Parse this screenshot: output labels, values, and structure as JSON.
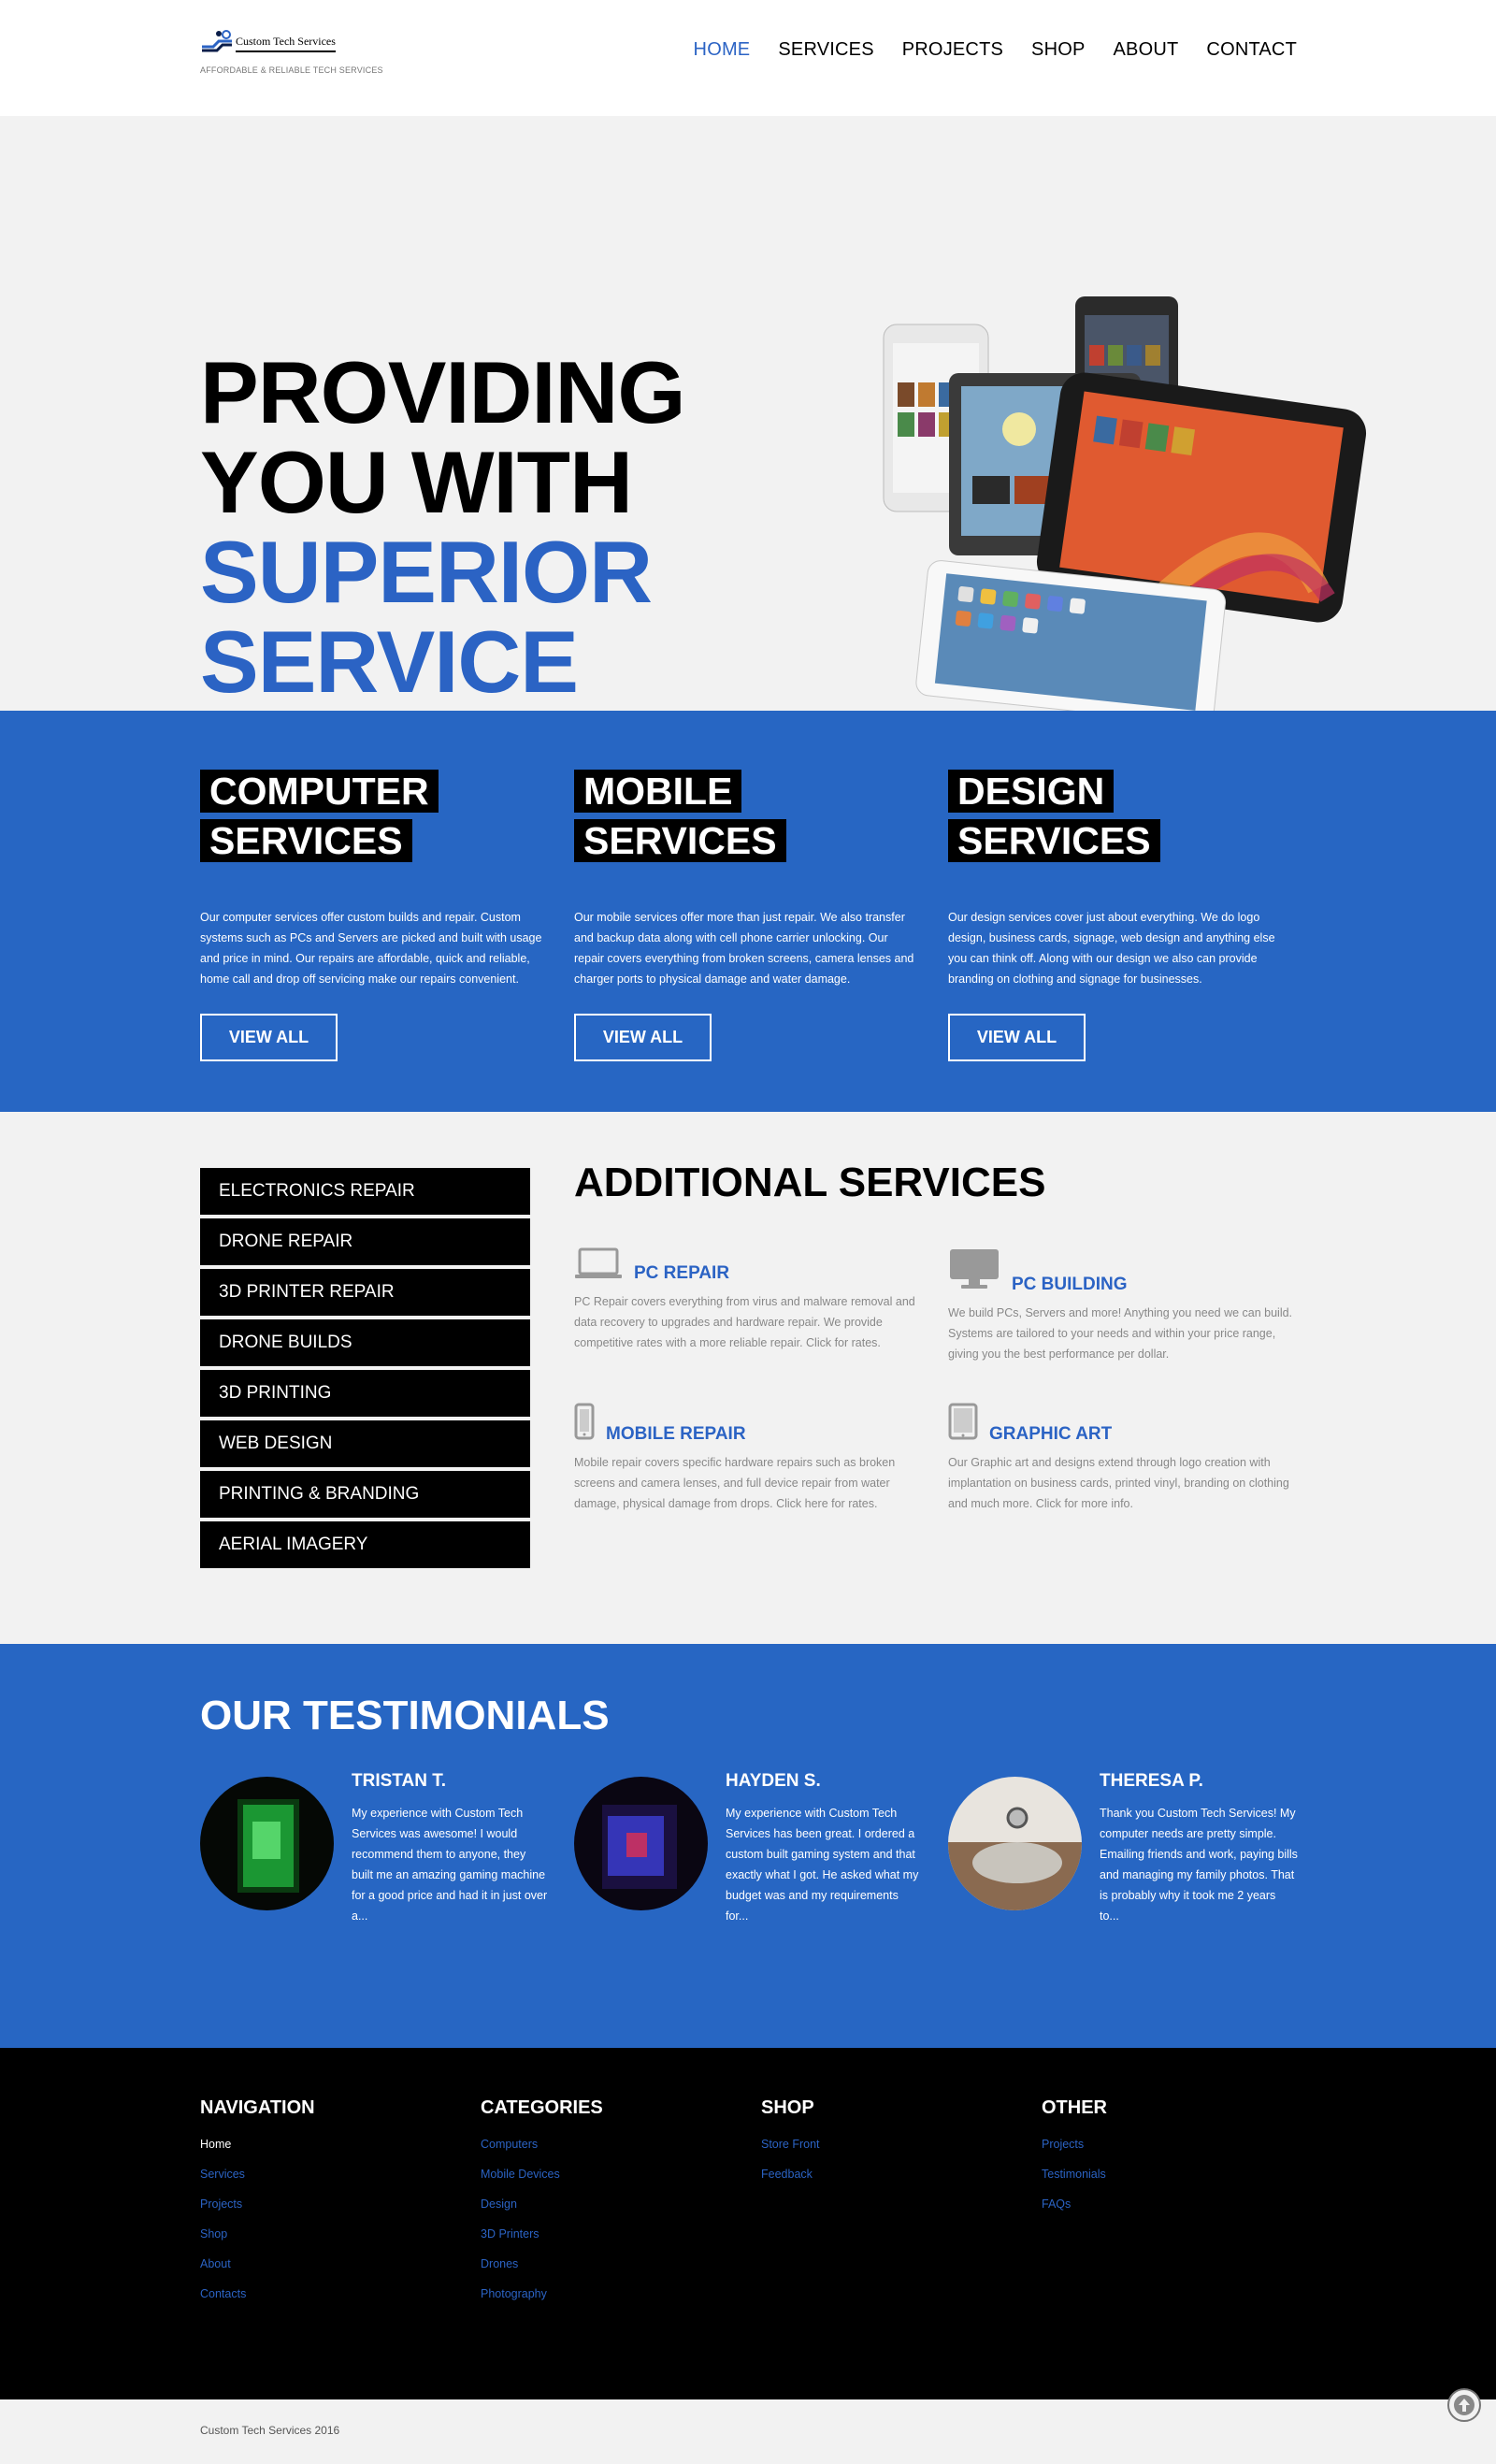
{
  "brand": {
    "name": "Custom Tech Services",
    "tagline": "AFFORDABLE & RELIABLE TECH SERVICES"
  },
  "nav": {
    "items": [
      "HOME",
      "SERVICES",
      "PROJECTS",
      "SHOP",
      "ABOUT",
      "CONTACT"
    ],
    "active": "HOME"
  },
  "hero": {
    "line1": "PROVIDING",
    "line2": "YOU WITH",
    "line3": "SUPERIOR",
    "line4": "SERVICE",
    "slide_count": 3,
    "active_slide": 1
  },
  "services": [
    {
      "title_line1": "COMPUTER",
      "title_line2": "SERVICES",
      "text": "Our computer services offer custom builds and repair. Custom systems such as PCs and Servers are picked and built with usage and price in mind. Our repairs are affordable, quick and reliable, home call and drop off servicing make our repairs convenient.",
      "button": "VIEW ALL"
    },
    {
      "title_line1": "MOBILE",
      "title_line2": "SERVICES",
      "text": "Our mobile services offer more than just repair. We also transfer and backup data along with cell phone carrier unlocking. Our repair covers everything from broken screens, camera lenses and charger ports to physical damage and water damage.",
      "button": "VIEW ALL"
    },
    {
      "title_line1": "DESIGN",
      "title_line2": "SERVICES",
      "text": "Our design services cover just about everything. We do logo design, business cards, signage, web design and anything else you can think off. Along with our design we also can provide branding on clothing and signage for businesses.",
      "button": "VIEW ALL"
    }
  ],
  "side_menu": [
    "ELECTRONICS REPAIR",
    "DRONE REPAIR",
    "3D PRINTER REPAIR",
    "DRONE BUILDS",
    "3D PRINTING",
    "WEB DESIGN",
    "PRINTING & BRANDING",
    "AERIAL IMAGERY"
  ],
  "additional": {
    "title": "ADDITIONAL SERVICES",
    "items": [
      {
        "label": "PC REPAIR",
        "icon": "laptop-icon",
        "text": "PC Repair covers everything from virus and malware removal and data recovery to upgrades and hardware repair. We provide competitive rates with a more reliable repair. Click for rates."
      },
      {
        "label": "PC BUILDING",
        "icon": "monitor-icon",
        "text": "We build PCs, Servers and more! Anything you need we can build. Systems are tailored to your needs and within your price range, giving you the best performance per dollar."
      },
      {
        "label": "MOBILE REPAIR",
        "icon": "phone-icon",
        "text": "Mobile repair covers specific hardware repairs such as broken screens and camera lenses, and full device repair from water damage, physical damage from drops. Click here for rates."
      },
      {
        "label": "GRAPHIC ART",
        "icon": "tablet-icon",
        "text": "Our Graphic art and designs extend through logo creation with implantation on business cards, printed vinyl, branding on clothing and much more. Click for more info."
      }
    ]
  },
  "testimonials": {
    "title": "OUR TESTIMONIALS",
    "items": [
      {
        "name": "TRISTAN T.",
        "text": "My experience with Custom Tech Services was awesome! I would recommend them to anyone, they built me an amazing gaming machine for a good price and had it in just over a..."
      },
      {
        "name": "HAYDEN S.",
        "text": "My experience with Custom Tech Services has been great. I ordered a custom built gaming system and that exactly what I got. He asked what my budget was and my requirements for..."
      },
      {
        "name": "THERESA P.",
        "text": "Thank you Custom Tech Services! My computer needs are pretty simple. Emailing friends and work, paying bills and managing my family photos. That is probably why it took me 2 years to..."
      }
    ]
  },
  "footer": {
    "columns": [
      {
        "heading": "NAVIGATION",
        "links": [
          "Home",
          "Services",
          "Projects",
          "Shop",
          "About",
          "Contacts"
        ]
      },
      {
        "heading": "CATEGORIES",
        "links": [
          "Computers",
          "Mobile Devices",
          "Design",
          "3D Printers",
          "Drones",
          "Photography"
        ]
      },
      {
        "heading": "SHOP",
        "links": [
          "Store Front",
          "Feedback"
        ]
      },
      {
        "heading": "OTHER",
        "links": [
          "Projects",
          "Testimonials",
          "FAQs"
        ]
      }
    ],
    "copyright": "Custom Tech Services 2016"
  },
  "colors": {
    "accent": "#2b63c4",
    "band": "#2766c3",
    "dark": "#000000",
    "light": "#f2f2f2"
  }
}
